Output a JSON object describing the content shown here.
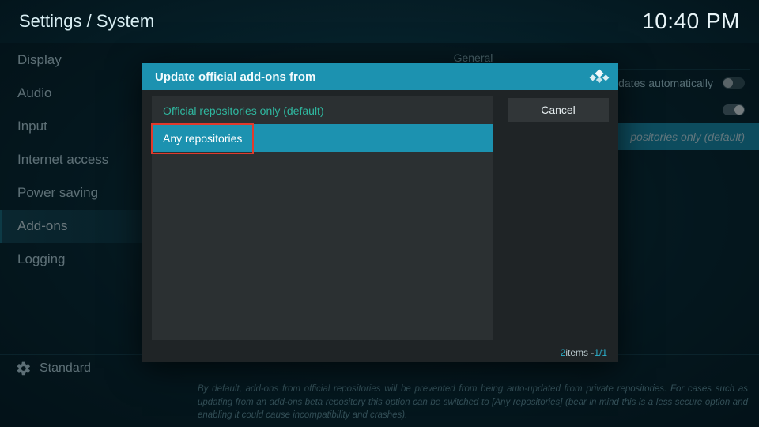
{
  "header": {
    "breadcrumb": "Settings / System",
    "clock": "10:40 PM"
  },
  "sidebar": {
    "items": [
      {
        "label": "Display",
        "active": false
      },
      {
        "label": "Audio",
        "active": false
      },
      {
        "label": "Input",
        "active": false
      },
      {
        "label": "Internet access",
        "active": false
      },
      {
        "label": "Power saving",
        "active": false
      },
      {
        "label": "Add-ons",
        "active": true
      },
      {
        "label": "Logging",
        "active": false
      }
    ]
  },
  "footer": {
    "level_label": "Standard"
  },
  "main": {
    "section": "General",
    "rows": {
      "updates_auto": {
        "label": "l updates automatically"
      },
      "unknown_sources": {
        "label": ""
      },
      "update_from": {
        "label": "",
        "value": "positories only (default)"
      }
    }
  },
  "dialog": {
    "title": "Update official add-ons from",
    "options": [
      {
        "label": "Official repositories only (default)",
        "kind": "default"
      },
      {
        "label": "Any repositories",
        "kind": "selected"
      }
    ],
    "cancel": "Cancel",
    "footer": {
      "count": "2",
      "items_word": " items - ",
      "page": "1/1"
    }
  },
  "hint": "By default, add-ons from official repositories will be prevented from being auto-updated from private repositories. For cases such as updating from an add-ons beta repository this option can be switched to [Any repositories] (bear in mind this is a less secure option and enabling it could cause incompatibility and crashes)."
}
